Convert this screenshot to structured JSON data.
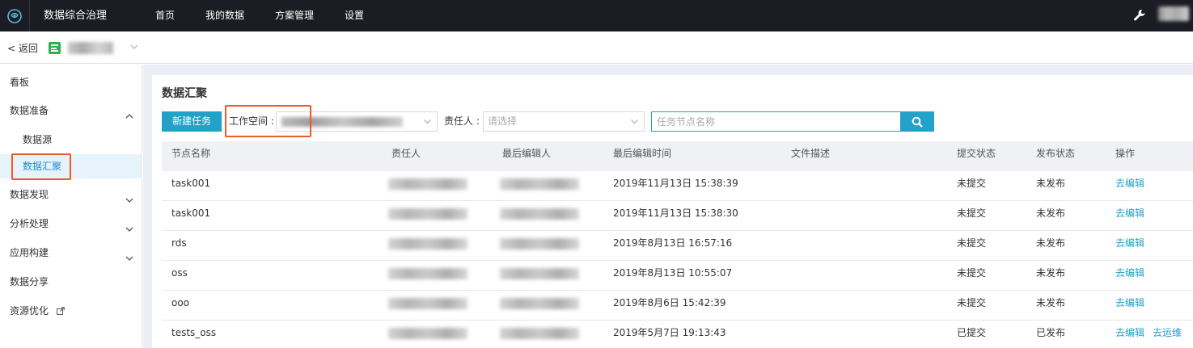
{
  "topbar": {
    "app_title": "数据综合治理",
    "nav": [
      "首页",
      "我的数据",
      "方案管理",
      "设置"
    ],
    "wrench_icon": "wrench-icon"
  },
  "subbar": {
    "back_label": "< 返回"
  },
  "sidebar": {
    "items": [
      {
        "label": "看板"
      },
      {
        "label": "数据准备",
        "expanded": true
      },
      {
        "label": "数据源"
      },
      {
        "label": "数据汇聚",
        "active": true
      },
      {
        "label": "数据发现",
        "expanded": false
      },
      {
        "label": "分析处理",
        "expanded": false
      },
      {
        "label": "应用构建",
        "expanded": false
      },
      {
        "label": "数据分享"
      },
      {
        "label": "资源优化"
      }
    ]
  },
  "main": {
    "title": "数据汇聚",
    "new_task_label": "新建任务",
    "workspace_label": "工作空间 :",
    "owner_label": "责任人 :",
    "owner_placeholder": "请选择",
    "search_placeholder": "任务节点名称"
  },
  "table": {
    "columns": [
      "节点名称",
      "责任人",
      "最后编辑人",
      "最后编辑时间",
      "文件描述",
      "提交状态",
      "发布状态",
      "操作"
    ],
    "rows": [
      {
        "name": "task001",
        "time": "2019年11月13日 15:38:39",
        "submit": "未提交",
        "publish": "未发布",
        "action": "去编辑",
        "action2": ""
      },
      {
        "name": "task001",
        "time": "2019年11月13日 15:38:30",
        "submit": "未提交",
        "publish": "未发布",
        "action": "去编辑",
        "action2": ""
      },
      {
        "name": "rds",
        "time": "2019年8月13日 16:57:16",
        "submit": "未提交",
        "publish": "未发布",
        "action": "去编辑",
        "action2": ""
      },
      {
        "name": "oss",
        "time": "2019年8月13日 10:55:07",
        "submit": "未提交",
        "publish": "未发布",
        "action": "去编辑",
        "action2": ""
      },
      {
        "name": "ooo",
        "time": "2019年8月6日 15:42:39",
        "submit": "未提交",
        "publish": "未发布",
        "action": "去编辑",
        "action2": ""
      },
      {
        "name": "tests_oss",
        "time": "2019年5月7日 19:13:43",
        "submit": "已提交",
        "publish": "已发布",
        "action": "去编辑",
        "action2": "去运维"
      }
    ]
  },
  "colors": {
    "accent": "#22a1c9",
    "highlight": "#f05a28",
    "topbar": "#1b1c24"
  }
}
